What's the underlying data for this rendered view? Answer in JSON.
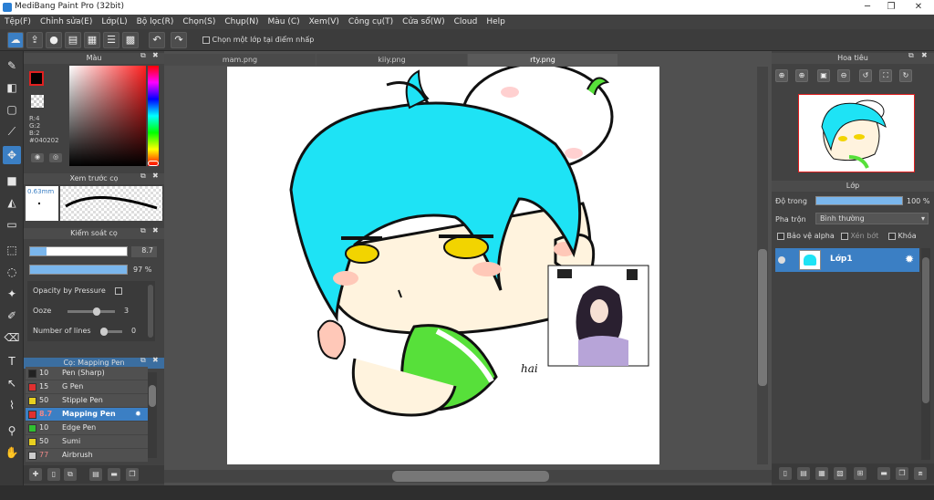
{
  "title": "MediBang Paint Pro (32bit)",
  "menu": [
    "Tệp(F)",
    "Chỉnh sửa(E)",
    "Lớp(L)",
    "Bộ lọc(R)",
    "Chọn(S)",
    "Chụp(N)",
    "Màu (C)",
    "Xem(V)",
    "Công cụ(T)",
    "Cửa sổ(W)",
    "Cloud",
    "Help"
  ],
  "toolbar": {
    "select_layer_label": "Chọn một lớp tại điểm nhấp"
  },
  "color_panel": {
    "title": "Màu",
    "r": "R:4",
    "g": "G:2",
    "b": "B:2",
    "hex": "#040202",
    "fg_color": "#040202"
  },
  "brush_preview": {
    "title": "Xem trước cọ",
    "size": "0.63mm"
  },
  "brush_control": {
    "title": "Kiểm soát cọ",
    "size_value": "8.7",
    "opacity_value": "97 %",
    "opacity_by_pressure": "Opacity by Pressure",
    "ooze_label": "Ooze",
    "ooze_value": "3",
    "lines_label": "Number of lines",
    "lines_value": "0"
  },
  "brush_list": {
    "title": "Cọ: Mapping Pen",
    "items": [
      {
        "size": "10",
        "name": "Pen (Sharp)",
        "color": "#222222"
      },
      {
        "size": "15",
        "name": "G Pen",
        "color": "#e03030"
      },
      {
        "size": "50",
        "name": "Stipple Pen",
        "color": "#e8d020"
      },
      {
        "size": "8.7",
        "name": "Mapping Pen",
        "color": "#e03030"
      },
      {
        "size": "10",
        "name": "Edge Pen",
        "color": "#30c030"
      },
      {
        "size": "50",
        "name": "Sumi",
        "color": "#e8d020"
      },
      {
        "size": "77",
        "name": "Airbrush",
        "color": "#cccccc"
      }
    ]
  },
  "tabs": [
    "mam.png",
    "kiiy.png",
    "rty.png"
  ],
  "navigator": {
    "title": "Hoa tiêu"
  },
  "layers": {
    "title": "Lớp",
    "opacity_label": "Độ trong",
    "opacity_value": "100 %",
    "blend_label": "Pha trộn",
    "blend_value": "Bình thường",
    "protect_alpha": "Bảo vệ alpha",
    "clipping": "Xén bớt",
    "lock": "Khóa",
    "layer_name": "Lớp1"
  },
  "colors": {
    "accent": "#3b7fc4",
    "hair": "#1ee3f5",
    "skin": "#fff3de",
    "eye": "#f2d400",
    "leaf": "#57e03a",
    "nav_frame": "#e02020"
  },
  "icons": [
    "new-icon",
    "share-icon",
    "comment-icon",
    "undo-icon",
    "redo-icon",
    "pen-icon",
    "eraser-icon",
    "hand-icon",
    "text-icon",
    "gear-icon"
  ]
}
